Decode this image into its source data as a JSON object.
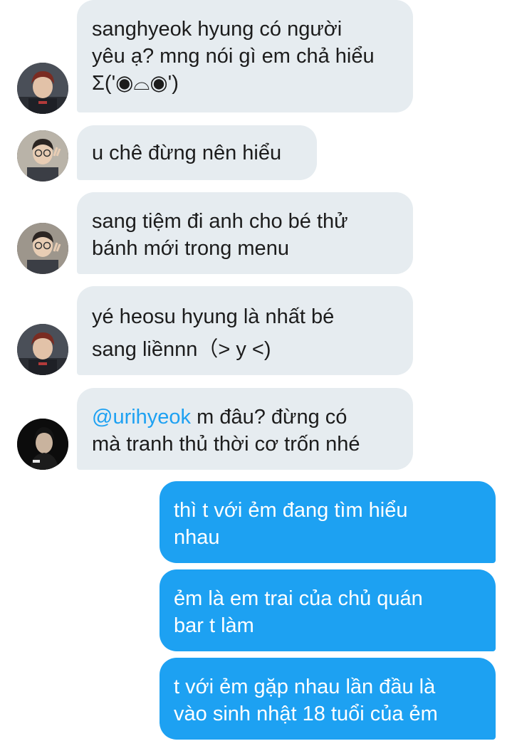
{
  "messages": [
    {
      "direction": "incoming",
      "avatar": "avatar-red-hair-man",
      "lines": [
        "sanghyeok hyung có người",
        "yêu ạ? mng nói gì em chả hiểu",
        "Σ('◉⌓◉')"
      ]
    },
    {
      "direction": "incoming",
      "avatar": "avatar-glasses-man-peace-sign",
      "lines": [
        "u chê đừng nên hiểu"
      ]
    },
    {
      "direction": "incoming",
      "avatar": "avatar-glasses-man-peace-sign",
      "lines": [
        "sang tiệm đi anh cho bé thử",
        "bánh mới trong menu"
      ]
    },
    {
      "direction": "incoming",
      "avatar": "avatar-red-hair-man",
      "lines": [
        "yé heosu hyung là nhất bé",
        "sang liềnnn（> y <)"
      ]
    },
    {
      "direction": "incoming",
      "avatar": "avatar-dark-portrait",
      "mention": "@urihyeok",
      "lines": [
        "m đâu? đừng có",
        "mà tranh thủ thời cơ trốn nhé"
      ]
    },
    {
      "direction": "outgoing",
      "lines": [
        "thì t với ẻm đang tìm hiểu",
        "nhau"
      ]
    },
    {
      "direction": "outgoing",
      "lines": [
        "ẻm là em trai của chủ quán",
        "bar t làm"
      ]
    },
    {
      "direction": "outgoing",
      "lines": [
        "t với ẻm gặp nhau lần đầu là",
        "vào sinh nhật 18 tuổi của ẻm"
      ]
    }
  ],
  "colors": {
    "incoming_bubble": "#e6ecf0",
    "outgoing_bubble": "#1da1f2",
    "mention": "#1da1f2",
    "text": "#1c1c1c"
  }
}
